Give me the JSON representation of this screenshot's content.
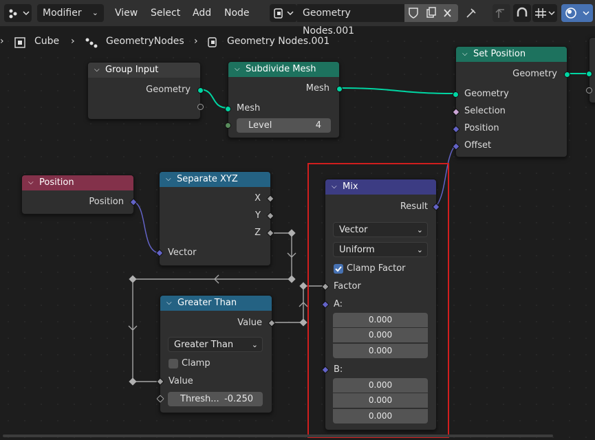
{
  "header": {
    "editor_icon": "node-editor-icon",
    "mode": "Modifier",
    "menus": [
      "View",
      "Select",
      "Add",
      "Node"
    ],
    "node_group_name": "Geometry Nodes.001"
  },
  "breadcrumb": {
    "items": [
      "Cube",
      "GeometryNodes",
      "Geometry Nodes.001"
    ]
  },
  "nodes": {
    "group_input": {
      "title": "Group Input",
      "outputs": [
        "Geometry"
      ]
    },
    "subdivide_mesh": {
      "title": "Subdivide Mesh",
      "output": "Mesh",
      "input": "Mesh",
      "level_label": "Level",
      "level_value": "4"
    },
    "set_position": {
      "title": "Set Position",
      "output": "Geometry",
      "inputs": [
        "Geometry",
        "Selection",
        "Position",
        "Offset"
      ]
    },
    "position": {
      "title": "Position",
      "output": "Position"
    },
    "separate_xyz": {
      "title": "Separate XYZ",
      "outputs": [
        "X",
        "Y",
        "Z"
      ],
      "input": "Vector"
    },
    "mix": {
      "title": "Mix",
      "output": "Result",
      "data_type": "Vector",
      "factor_mode": "Uniform",
      "clamp_factor_label": "Clamp Factor",
      "clamp_factor_checked": true,
      "factor_label": "Factor",
      "a_label": "A:",
      "a_values": [
        "0.000",
        "0.000",
        "0.000"
      ],
      "b_label": "B:",
      "b_values": [
        "0.000",
        "0.000",
        "0.000"
      ]
    },
    "greater_than": {
      "title": "Greater Than",
      "output": "Value",
      "operation": "Greater Than",
      "clamp_label": "Clamp",
      "clamp_checked": false,
      "value_label": "Value",
      "threshold_label": "Thresh...",
      "threshold_value": "-0.250"
    }
  },
  "colors": {
    "geometry_header": "#1d725e",
    "input_header": "#83314a",
    "converter_header": "#246283",
    "shader_header": "#3c3c83",
    "geometry_socket": "#00d6a3",
    "vector_socket": "#6363c7",
    "float_socket": "#a1a1a1",
    "selection_outline": "#d21e1e"
  }
}
